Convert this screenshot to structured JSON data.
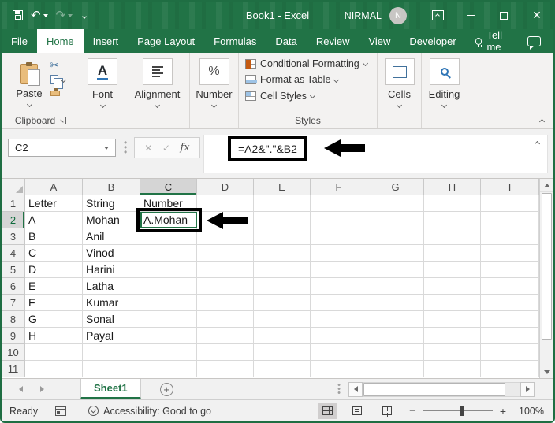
{
  "window": {
    "title": "Book1 - Excel",
    "user": "NIRMAL",
    "avatar_initial": "N"
  },
  "tabs": {
    "items": [
      "File",
      "Home",
      "Insert",
      "Page Layout",
      "Formulas",
      "Data",
      "Review",
      "View",
      "Developer"
    ],
    "selected": "Home",
    "tell_me": "Tell me"
  },
  "ribbon": {
    "paste_label": "Paste",
    "clipboard_label": "Clipboard",
    "font_label": "Font",
    "alignment_label": "Alignment",
    "number_label": "Number",
    "number_glyph": "%",
    "styles": {
      "items": [
        "Conditional Formatting",
        "Format as Table",
        "Cell Styles"
      ],
      "label": "Styles"
    },
    "cells_label": "Cells",
    "editing_label": "Editing"
  },
  "formula_bar": {
    "name_box": "C2",
    "cancel_glyph": "✕",
    "enter_glyph": "✓",
    "fx_label": "fx",
    "formula": "=A2&\".\"&B2"
  },
  "grid": {
    "columns": [
      "A",
      "B",
      "C",
      "D",
      "E",
      "F",
      "G",
      "H",
      "I"
    ],
    "selected_column": "C",
    "selected_row": 2,
    "rows": [
      {
        "n": 1,
        "cells": [
          "Letter",
          "String",
          "Number",
          "",
          "",
          "",
          "",
          "",
          ""
        ]
      },
      {
        "n": 2,
        "cells": [
          "A",
          "Mohan",
          "A.Mohan",
          "",
          "",
          "",
          "",
          "",
          ""
        ]
      },
      {
        "n": 3,
        "cells": [
          "B",
          "Anil",
          "",
          "",
          "",
          "",
          "",
          "",
          ""
        ]
      },
      {
        "n": 4,
        "cells": [
          "C",
          "Vinod",
          "",
          "",
          "",
          "",
          "",
          "",
          ""
        ]
      },
      {
        "n": 5,
        "cells": [
          "D",
          "Harini",
          "",
          "",
          "",
          "",
          "",
          "",
          ""
        ]
      },
      {
        "n": 6,
        "cells": [
          "E",
          "Latha",
          "",
          "",
          "",
          "",
          "",
          "",
          ""
        ]
      },
      {
        "n": 7,
        "cells": [
          "F",
          "Kumar",
          "",
          "",
          "",
          "",
          "",
          "",
          ""
        ]
      },
      {
        "n": 8,
        "cells": [
          "G",
          "Sonal",
          "",
          "",
          "",
          "",
          "",
          "",
          ""
        ]
      },
      {
        "n": 9,
        "cells": [
          "H",
          "Payal",
          "",
          "",
          "",
          "",
          "",
          "",
          ""
        ]
      },
      {
        "n": 10,
        "cells": [
          "",
          "",
          "",
          "",
          "",
          "",
          "",
          "",
          ""
        ]
      },
      {
        "n": 11,
        "cells": [
          "",
          "",
          "",
          "",
          "",
          "",
          "",
          "",
          ""
        ]
      }
    ]
  },
  "sheet_tabs": {
    "active": "Sheet1",
    "add_glyph": "+"
  },
  "status_bar": {
    "ready": "Ready",
    "accessibility": "Accessibility: Good to go",
    "zoom": "100%"
  },
  "colors": {
    "excel_green": "#217346",
    "selection_green": "#217346",
    "annotation_black": "#000000"
  }
}
